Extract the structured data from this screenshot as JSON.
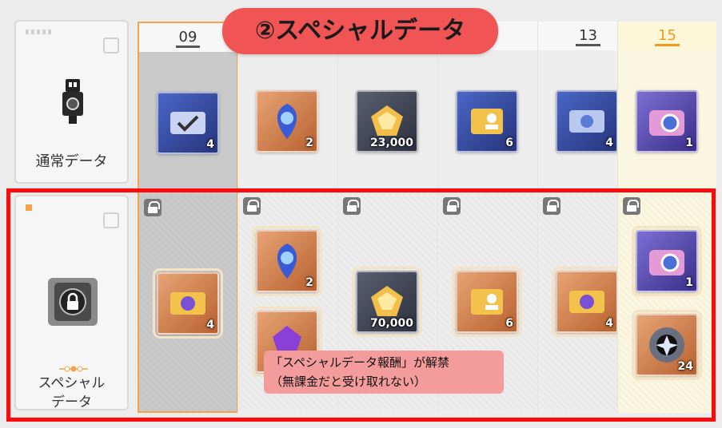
{
  "title_banner": "②スペシャルデータ",
  "rows": {
    "normal_label": "通常データ",
    "special_label_line1": "スペシャル",
    "special_label_line2": "データ"
  },
  "days": [
    {
      "day": "09",
      "normal": {
        "icon": "ticket-check-icon",
        "qty": "4"
      },
      "special": [
        {
          "icon": "gold-ticket-icon",
          "qty": "4"
        }
      ]
    },
    {
      "day": "",
      "normal": {
        "icon": "crystal-orb-icon",
        "qty": "2"
      },
      "special": [
        {
          "icon": "crystal-orb-icon",
          "qty": "2"
        },
        {
          "icon": "purple-gem-icon",
          "qty": ""
        }
      ]
    },
    {
      "day": "",
      "normal": {
        "icon": "gold-cube-icon",
        "qty": "23,000"
      },
      "special": [
        {
          "icon": "gold-cube-icon",
          "qty": "70,000"
        }
      ]
    },
    {
      "day": "",
      "normal": {
        "icon": "id-card-icon",
        "qty": "6"
      },
      "special": [
        {
          "icon": "id-card-icon",
          "qty": "6"
        }
      ]
    },
    {
      "day": "13",
      "normal": {
        "icon": "blue-ticket-icon",
        "qty": "4"
      },
      "special": [
        {
          "icon": "gold-ticket-icon",
          "qty": "4"
        }
      ]
    },
    {
      "day": "15",
      "normal": {
        "icon": "camera-icon",
        "qty": "1"
      },
      "special": [
        {
          "icon": "camera-icon",
          "qty": "1"
        },
        {
          "icon": "emblem-icon",
          "qty": "24"
        }
      ]
    }
  ],
  "note_line1": "「スペシャルデータ報酬」が解禁",
  "note_line2": "（無課金だと受け取れない）",
  "colors": {
    "banner": "#f05454",
    "frame": "#ff0a0a",
    "note": "#f49b9b",
    "accent": "#f29a1e"
  }
}
